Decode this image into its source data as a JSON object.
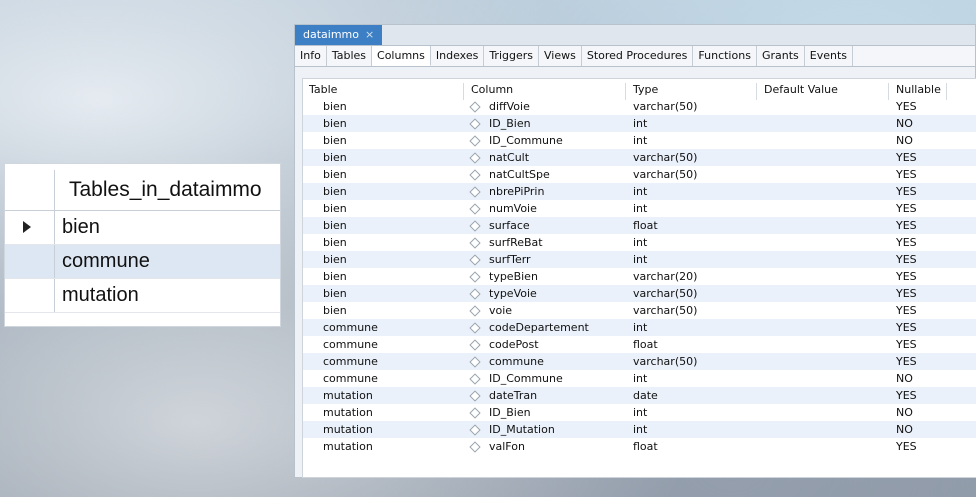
{
  "left_grid": {
    "header": "Tables_in_dataimmo",
    "rows": [
      "bien",
      "commune",
      "mutation"
    ]
  },
  "panel": {
    "doc_tab": {
      "label": "dataimmo",
      "close": "×"
    },
    "tabs": [
      "Info",
      "Tables",
      "Columns",
      "Indexes",
      "Triggers",
      "Views",
      "Stored Procedures",
      "Functions",
      "Grants",
      "Events"
    ],
    "active_tab": "Columns",
    "columns": {
      "headers": [
        "Table",
        "Column",
        "Type",
        "Default Value",
        "Nullable"
      ],
      "rows": [
        [
          "bien",
          "diffVoie",
          "varchar(50)",
          "",
          "YES"
        ],
        [
          "bien",
          "ID_Bien",
          "int",
          "",
          "NO"
        ],
        [
          "bien",
          "ID_Commune",
          "int",
          "",
          "NO"
        ],
        [
          "bien",
          "natCult",
          "varchar(50)",
          "",
          "YES"
        ],
        [
          "bien",
          "natCultSpe",
          "varchar(50)",
          "",
          "YES"
        ],
        [
          "bien",
          "nbrePiPrin",
          "int",
          "",
          "YES"
        ],
        [
          "bien",
          "numVoie",
          "int",
          "",
          "YES"
        ],
        [
          "bien",
          "surface",
          "float",
          "",
          "YES"
        ],
        [
          "bien",
          "surfReBat",
          "int",
          "",
          "YES"
        ],
        [
          "bien",
          "surfTerr",
          "int",
          "",
          "YES"
        ],
        [
          "bien",
          "typeBien",
          "varchar(20)",
          "",
          "YES"
        ],
        [
          "bien",
          "typeVoie",
          "varchar(50)",
          "",
          "YES"
        ],
        [
          "bien",
          "voie",
          "varchar(50)",
          "",
          "YES"
        ],
        [
          "commune",
          "codeDepartement",
          "int",
          "",
          "YES"
        ],
        [
          "commune",
          "codePost",
          "float",
          "",
          "YES"
        ],
        [
          "commune",
          "commune",
          "varchar(50)",
          "",
          "YES"
        ],
        [
          "commune",
          "ID_Commune",
          "int",
          "",
          "NO"
        ],
        [
          "mutation",
          "dateTran",
          "date",
          "",
          "YES"
        ],
        [
          "mutation",
          "ID_Bien",
          "int",
          "",
          "NO"
        ],
        [
          "mutation",
          "ID_Mutation",
          "int",
          "",
          "NO"
        ],
        [
          "mutation",
          "valFon",
          "float",
          "",
          "YES"
        ]
      ]
    }
  }
}
